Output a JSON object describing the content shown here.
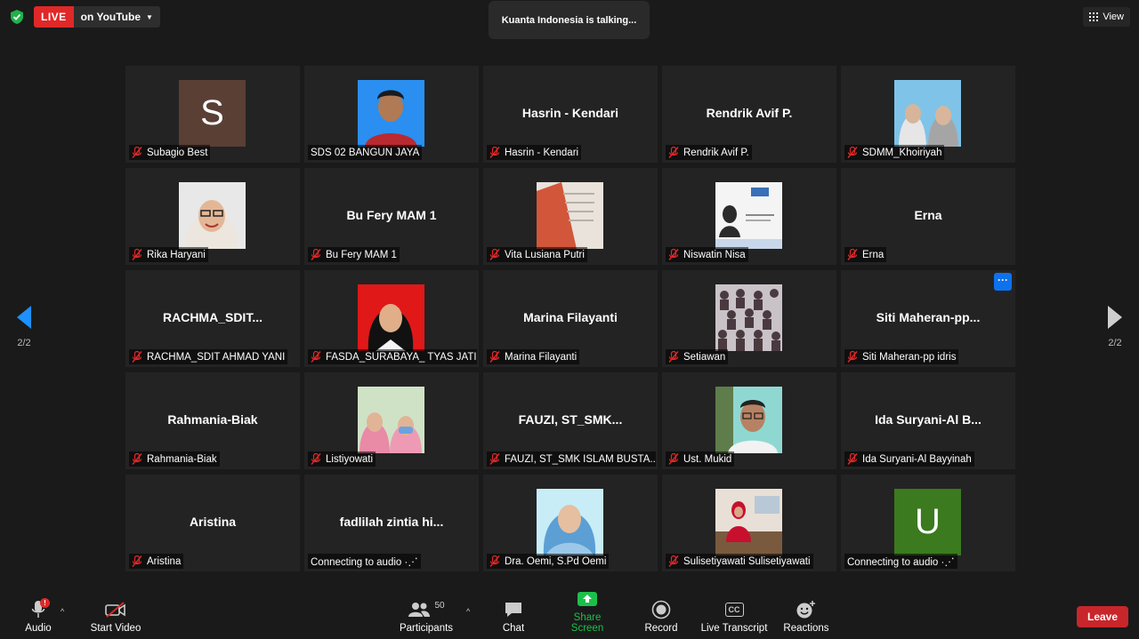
{
  "topbar": {
    "live_label": "LIVE",
    "live_destination": "on YouTube",
    "talking_indicator": "Kuanta Indonesia is talking...",
    "view_label": "View"
  },
  "pagination": {
    "left": "2/2",
    "right": "2/2"
  },
  "participants": [
    {
      "center_name": "",
      "label": "Subagio Best",
      "avatar": "letter",
      "letter": "S",
      "letter_bg": "#5a3f35",
      "muted": true
    },
    {
      "center_name": "",
      "label": "SDS 02 BANGUN JAYA",
      "avatar": "photo-man-red-shirt",
      "muted": false
    },
    {
      "center_name": "Hasrin - Kendari",
      "label": "Hasrin - Kendari",
      "avatar": "none",
      "muted": true
    },
    {
      "center_name": "Rendrik Avif P.",
      "label": "Rendrik Avif P.",
      "avatar": "none",
      "muted": true
    },
    {
      "center_name": "",
      "label": "SDMM_Khoiriyah",
      "avatar": "photo-two-women-hijab",
      "muted": true
    },
    {
      "center_name": "",
      "label": "Rika Haryani",
      "avatar": "photo-woman-hijab-glasses",
      "muted": true
    },
    {
      "center_name": "Bu Fery MAM 1",
      "label": "Bu Fery MAM 1",
      "avatar": "none",
      "muted": true
    },
    {
      "center_name": "",
      "label": "Vita Lusiana Putri",
      "avatar": "photo-document",
      "muted": true
    },
    {
      "center_name": "",
      "label": "Niswatin Nisa",
      "avatar": "photo-certificate",
      "muted": true
    },
    {
      "center_name": "Erna",
      "label": "Erna",
      "avatar": "none",
      "muted": true
    },
    {
      "center_name": "RACHMA_SDIT...",
      "label": "RACHMA_SDIT AHMAD YANI",
      "avatar": "none",
      "muted": true
    },
    {
      "center_name": "",
      "label": "FASDA_SURABAYA_ TYAS JATI...",
      "avatar": "photo-woman-hijab-red-bg",
      "muted": true
    },
    {
      "center_name": "Marina Filayanti",
      "label": "Marina Filayanti",
      "avatar": "none",
      "muted": true
    },
    {
      "center_name": "",
      "label": "Setiawan",
      "avatar": "photo-crowd",
      "muted": true
    },
    {
      "center_name": "Siti  Maheran-pp...",
      "label": "Siti Maheran-pp idris",
      "avatar": "none",
      "muted": true,
      "more_button": "···"
    },
    {
      "center_name": "Rahmania-Biak",
      "label": "Rahmania-Biak",
      "avatar": "none",
      "muted": true
    },
    {
      "center_name": "",
      "label": "Listiyowati",
      "avatar": "photo-two-women-mask",
      "muted": true
    },
    {
      "center_name": "FAUZI,  ST_SMK...",
      "label": "FAUZI, ST_SMK ISLAM BUSTA...",
      "avatar": "none",
      "muted": true
    },
    {
      "center_name": "",
      "label": "Ust. Mukid",
      "avatar": "photo-man-glasses",
      "muted": true
    },
    {
      "center_name": "Ida Suryani-Al B...",
      "label": "Ida Suryani-Al Bayyinah",
      "avatar": "none",
      "muted": true
    },
    {
      "center_name": "Aristina",
      "label": "Aristina",
      "avatar": "none",
      "muted": true
    },
    {
      "center_name": "fadlilah  zintia  hi...",
      "label": "Connecting to audio ·⋰",
      "avatar": "none",
      "muted": false
    },
    {
      "center_name": "",
      "label": "Dra. Oemi, S.Pd Oemi",
      "avatar": "photo-woman-blue-hijab",
      "muted": true
    },
    {
      "center_name": "",
      "label": "Sulisetiyawati Sulisetiyawati",
      "avatar": "photo-woman-red-dress",
      "muted": true
    },
    {
      "center_name": "",
      "label": "Connecting to audio ·⋰",
      "avatar": "letter",
      "letter": "U",
      "letter_bg": "#3b7a1e",
      "muted": false
    }
  ],
  "toolbar": {
    "audio_label": "Audio",
    "audio_badge": "!",
    "video_label": "Start Video",
    "participants_label": "Participants",
    "participants_count": "50",
    "chat_label": "Chat",
    "share_label": "Share Screen",
    "record_label": "Record",
    "transcript_label": "Live Transcript",
    "transcript_icon_text": "CC",
    "reactions_label": "Reactions",
    "leave_label": "Leave",
    "share_color": "#1bc04a",
    "leave_color": "#c8262b"
  }
}
